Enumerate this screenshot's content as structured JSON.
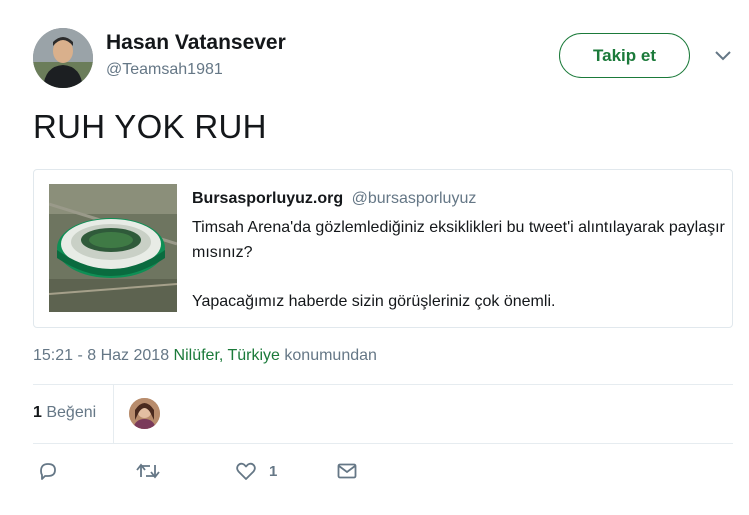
{
  "author": {
    "name": "Hasan Vatansever",
    "handle": "@Teamsah1981"
  },
  "follow_button": "Takip et",
  "tweet_text": "RUH YOK RUH",
  "quoted": {
    "name": "Bursasporluyuz.org",
    "handle": "@bursasporluyuz",
    "body_line1": "Timsah Arena'da gözlemlediğiniz eksiklikleri bu tweet'i alıntılayarak paylaşır mısınız?",
    "body_line2": "Yapacağımız haberde sizin görüşleriniz çok önemli."
  },
  "meta": {
    "time": "15:21 - 8 Haz 2018",
    "location": "Nilüfer, Türkiye",
    "location_suffix": "konumundan"
  },
  "stats": {
    "likes_count": "1",
    "likes_label": "Beğeni"
  },
  "actions": {
    "like_count": "1"
  },
  "colors": {
    "accent": "#1b7a3a",
    "secondary_text": "#657786",
    "border": "#e1e8ed"
  }
}
